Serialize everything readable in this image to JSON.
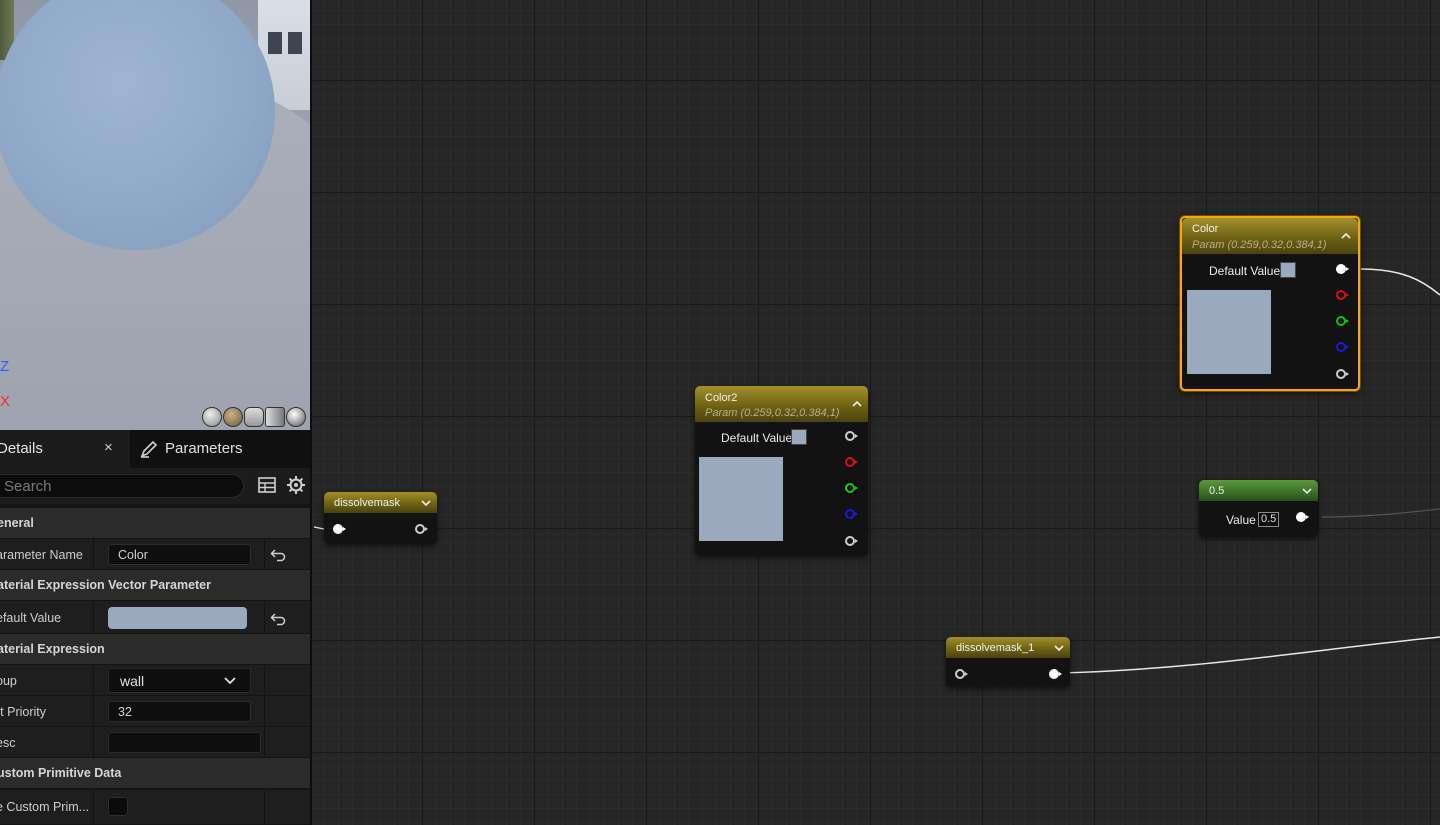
{
  "viewport": {
    "axis_z": "Z",
    "axis_x": "X"
  },
  "panel": {
    "tab_details": "Details",
    "tab_close": "×",
    "tab_parameters": "Parameters",
    "search_placeholder": "Search",
    "rows": {
      "general": "eneral",
      "param_name_label": "arameter Name",
      "param_name_value": "Color",
      "mevp": "aterial Expression Vector Parameter",
      "default_value_label": "efault Value",
      "default_value_color": "#9aa9bd",
      "material_expression": "aterial Expression",
      "group_label": "oup",
      "group_value": "wall",
      "sort_priority_label": "rt Priority",
      "sort_priority_value": "32",
      "desc_label": "esc",
      "desc_value": "",
      "custom_primitive_data": "ustom Primitive Data",
      "use_custom_prim_label": "e Custom Prim...",
      "use_custom_prim_checked": false
    }
  },
  "nodes": {
    "color": {
      "title": "Color",
      "subtitle": "Param (0.259,0.32,0.384,1)",
      "default_value_label": "Default Value",
      "color": "#9aa9bd"
    },
    "color2": {
      "title": "Color2",
      "subtitle": "Param (0.259,0.32,0.384,1)",
      "default_value_label": "Default Value",
      "color": "#9aa9bd"
    },
    "dissolvemask": {
      "title": "dissolvemask"
    },
    "dissolvemask_1": {
      "title": "dissolvemask_1"
    },
    "scalar": {
      "title": "0.5",
      "value_label": "Value",
      "value": "0.5"
    }
  }
}
